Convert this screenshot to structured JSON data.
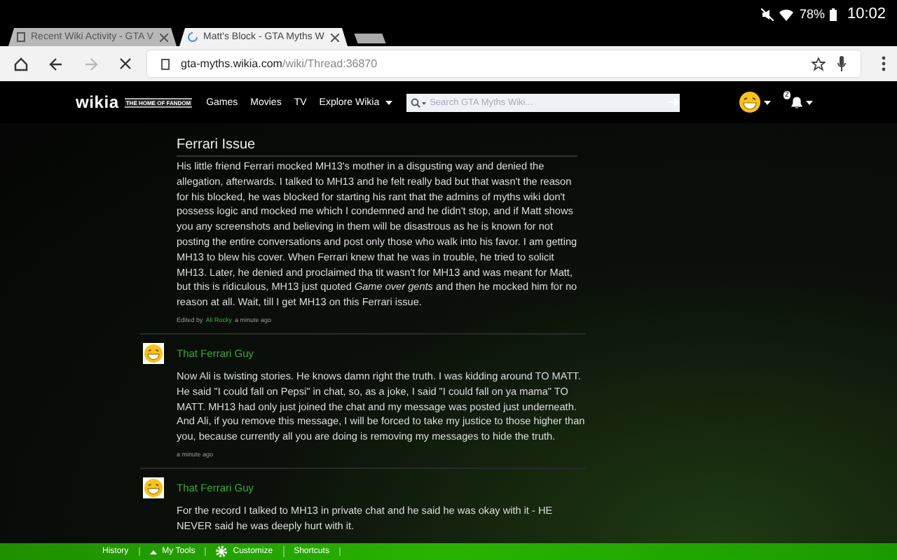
{
  "status_bar": {
    "battery": "78%",
    "time": "10:02"
  },
  "tabs": [
    {
      "title": "Recent Wiki Activity - GTA V",
      "selected": false,
      "loading": false
    },
    {
      "title": "Matt's Block - GTA Myths W",
      "selected": true,
      "loading": true
    }
  ],
  "address_bar": {
    "host": "gta-myths.wikia.com",
    "path": "/wiki/Thread:36870"
  },
  "wiki_nav": {
    "logo": "wikia",
    "tagline": "THE HOME OF FANDOM",
    "links": [
      {
        "label": "Games",
        "dropdown": false
      },
      {
        "label": "Movies",
        "dropdown": false
      },
      {
        "label": "TV",
        "dropdown": false
      },
      {
        "label": "Explore Wikia",
        "dropdown": true
      }
    ],
    "search": {
      "placeholder": "Search GTA Myths Wiki..."
    },
    "notifications": "2"
  },
  "thread": {
    "title": "Ferrari Issue",
    "body": "His little friend Ferrari mocked MH13's mother in a disgusting way and denied the allegation, afterwards. I talked to MH13 and he felt really bad but that wasn't the reason for his blocked, he was blocked for starting his rant that the admins of myths wiki don't possess logic and mocked me which I condemned and he didn't stop, and if Matt shows you any screenshots and believing in them will be disastrous as he is known for not posting the entire conversations and post only those who walk into his favor. I am getting MH13 to blew his cover. When Ferrari knew that he was in trouble, he tried to solicit MH13. Later, he denied and proclaimed tha tit wasn't for MH13 and was meant for Matt, but this is ridiculous, MH13 just quoted *Game over gents* and then he mocked him for no reason at all. Wait, till I get MH13 on this Ferrari issue.",
    "edited_prefix": "Edited by",
    "editor": "Ali Rocky",
    "edited_time": "a minute ago"
  },
  "replies": [
    {
      "author": "That Ferrari Guy",
      "body": "Now Ali is twisting stories. He knows damn right the truth. I was kidding around TO MATT. He said \"I could fall on Pepsi\" in chat, so, as a joke, I said \"I could fall on ya mama\" TO MATT. MH13 had only just joined the chat and my message was posted just underneath. And Ali, if you remove this message, I will be forced to take my justice to those higher than you,  because currently all you are doing is removing my messages to hide the truth.",
      "time": "a minute ago"
    },
    {
      "author": "That Ferrari Guy",
      "body": "For the record I talked to MH13 in private chat and he said he was okay with it - HE NEVER said he was deeply hurt with it."
    }
  ],
  "toolbar": [
    {
      "label": "History",
      "kind": "plain"
    },
    {
      "label": "My Tools",
      "kind": "menu"
    },
    {
      "label": "Customize",
      "kind": "gear"
    },
    {
      "label": "Shortcuts",
      "kind": "plain"
    }
  ]
}
